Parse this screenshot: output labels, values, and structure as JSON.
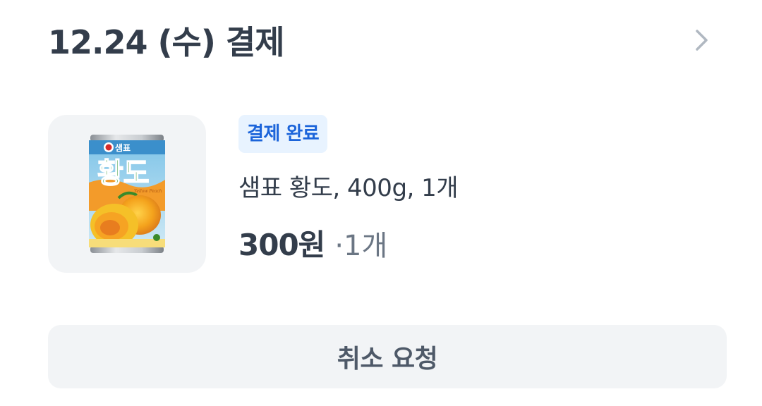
{
  "order": {
    "date_title": "12.24 (수) 결제",
    "detail_icon": "chevron-right-icon"
  },
  "item": {
    "status_badge": "결제 완료",
    "name": "샘표 황도, 400g, 1개",
    "price": "300원",
    "quantity": "·1개",
    "image": {
      "icon": "canned-peach-product-image",
      "brand_text": "샘표",
      "label_text": "황도",
      "sub_text": "Yellow Peach"
    }
  },
  "actions": {
    "cancel_label": "취소 요청"
  },
  "colors": {
    "text_primary": "#333d4b",
    "text_secondary": "#6b7684",
    "badge_bg": "#e8f3ff",
    "badge_text": "#1b64da",
    "button_bg": "#f2f4f6",
    "chevron": "#b0b8c1"
  }
}
